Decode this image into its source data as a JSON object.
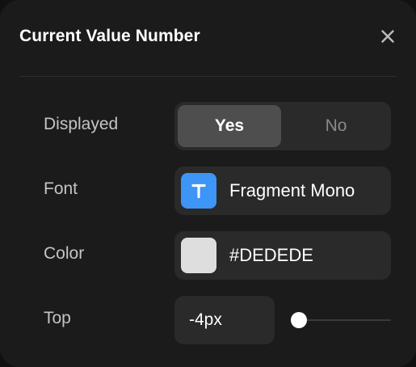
{
  "panel": {
    "title": "Current Value Number"
  },
  "rows": {
    "displayed": {
      "label": "Displayed",
      "options": [
        "Yes",
        "No"
      ],
      "selected": "Yes"
    },
    "font": {
      "label": "Font",
      "value": "Fragment Mono",
      "icon": "text-t-icon",
      "icon_color": "#3D95F5"
    },
    "color": {
      "label": "Color",
      "value": "#DEDEDE",
      "swatch": "#DEDEDE"
    },
    "top": {
      "label": "Top",
      "value": "-4px",
      "slider_fraction": 0.08
    }
  }
}
